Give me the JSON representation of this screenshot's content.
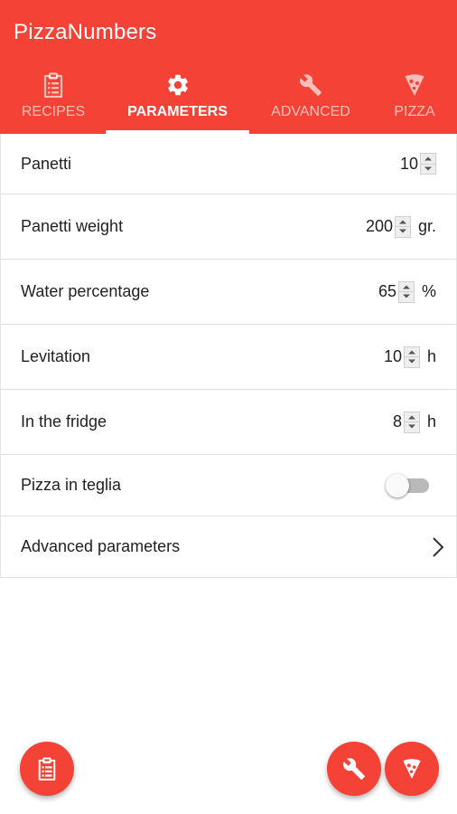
{
  "app": {
    "title": "PizzaNumbers",
    "accent_color": "#f44336"
  },
  "tabs": [
    {
      "label": "RECIPES",
      "icon": "clipboard-icon",
      "active": false
    },
    {
      "label": "PARAMETERS",
      "icon": "gear-icon",
      "active": true
    },
    {
      "label": "ADVANCED",
      "icon": "wrench-icon",
      "active": false
    },
    {
      "label": "PIZZA",
      "icon": "pizza-slice-icon",
      "active": false
    }
  ],
  "parameters": {
    "panetti": {
      "label": "Panetti",
      "value": "10"
    },
    "panetti_weight": {
      "label": "Panetti weight",
      "value": "200",
      "unit": "gr."
    },
    "water_percentage": {
      "label": "Water percentage",
      "value": "65",
      "unit": "%"
    },
    "levitation": {
      "label": "Levitation",
      "value": "10",
      "unit": "h"
    },
    "fridge": {
      "label": "In the fridge",
      "value": "8",
      "unit": "h"
    },
    "pizza_in_teglia": {
      "label": "Pizza in teglia",
      "enabled": false
    },
    "advanced": {
      "label": "Advanced parameters",
      "icon": "chevron-right-icon"
    }
  },
  "fabs": [
    {
      "icon": "clipboard-icon"
    },
    {
      "icon": "wrench-icon"
    },
    {
      "icon": "pizza-slice-icon"
    }
  ]
}
